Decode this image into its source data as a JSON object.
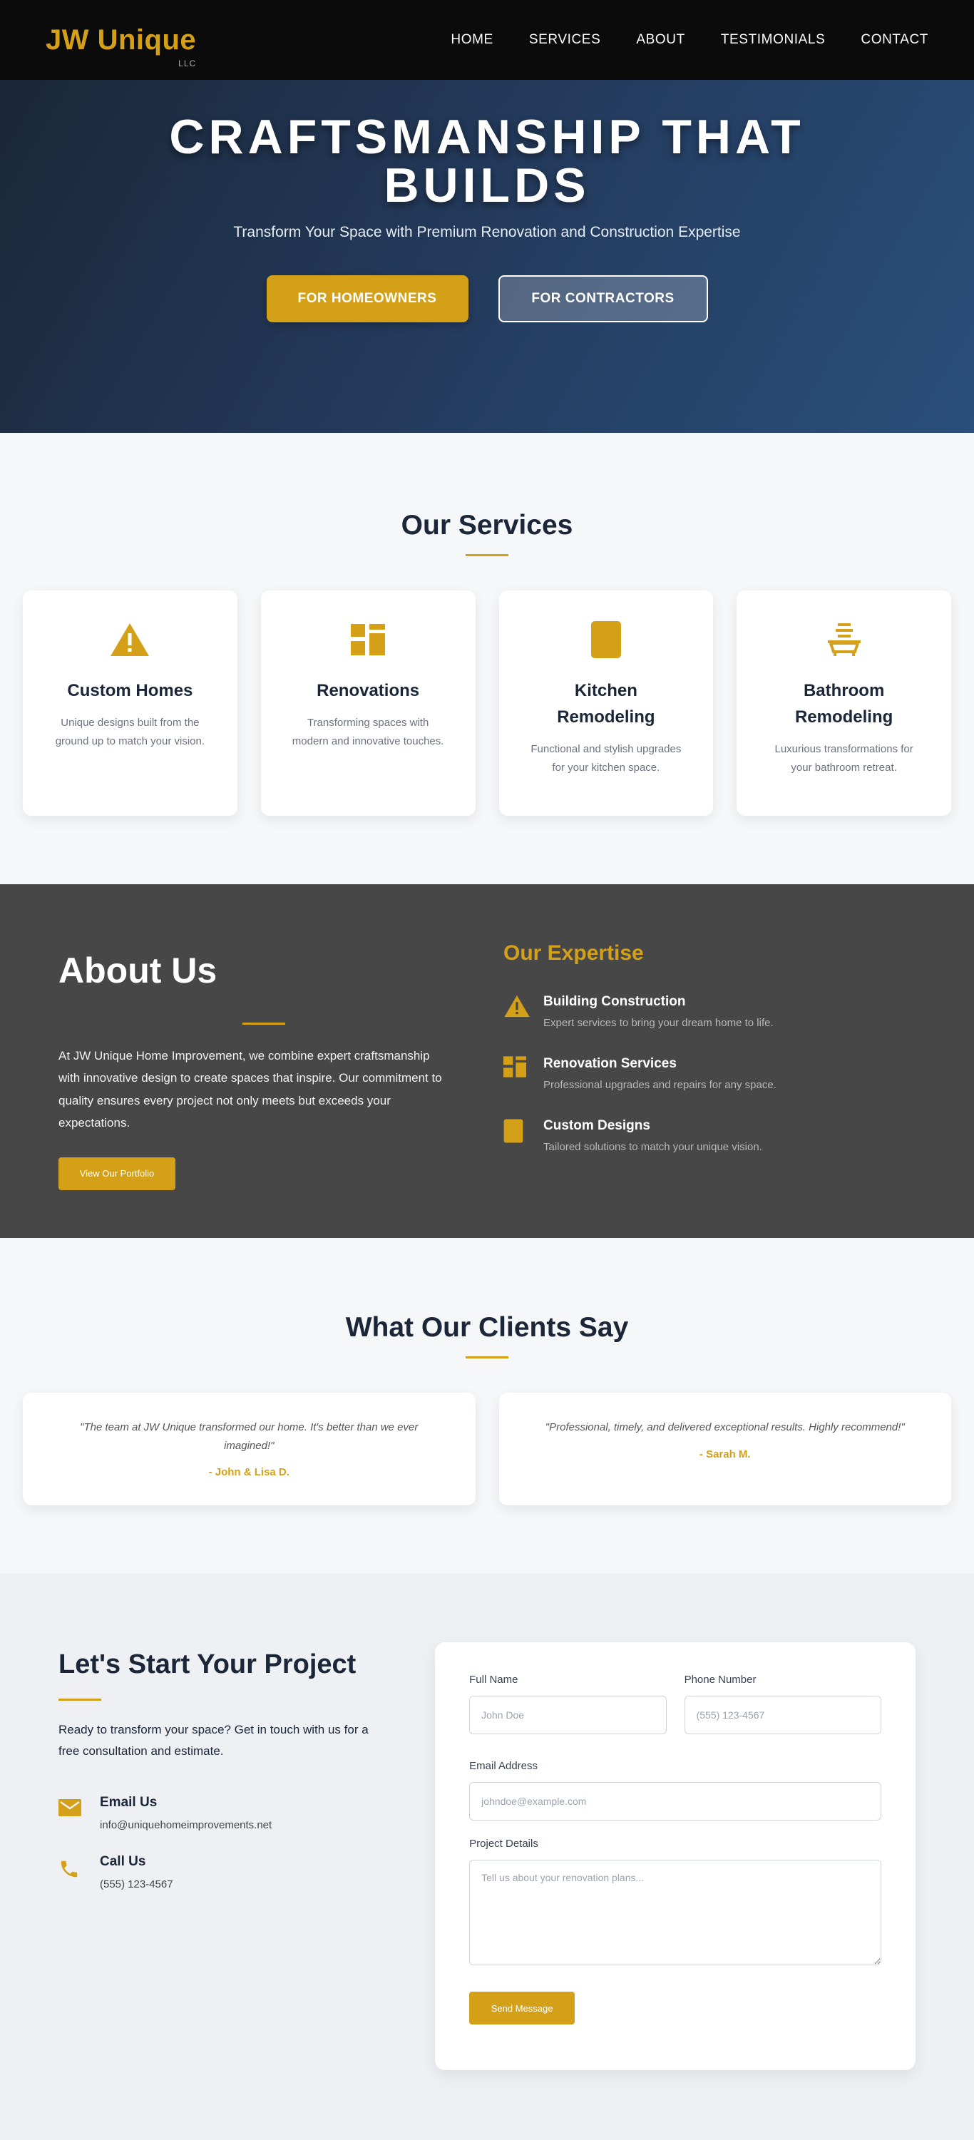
{
  "nav": {
    "brand": "JW Unique",
    "brand_sub": "LLC",
    "items": [
      "HOME",
      "SERVICES",
      "ABOUT",
      "TESTIMONIALS",
      "CONTACT"
    ]
  },
  "hero": {
    "title": "CRAFTSMANSHIP THAT BUILDS",
    "subtitle": "Transform Your Space with Premium Renovation and Construction Expertise",
    "btn_homeowners": "FOR HOMEOWNERS",
    "btn_contractors": "FOR CONTRACTORS"
  },
  "services": {
    "title": "Our Services",
    "items": [
      {
        "icon": "warning-icon",
        "title": "Custom Homes",
        "desc": "Unique designs built from the ground up to match your vision."
      },
      {
        "icon": "grid-icon",
        "title": "Renovations",
        "desc": "Transforming spaces with modern and innovative touches."
      },
      {
        "icon": "tablet-icon",
        "title": "Kitchen Remodeling",
        "desc": "Functional and stylish upgrades for your kitchen space."
      },
      {
        "icon": "bathtub-icon",
        "title": "Bathroom Remodeling",
        "desc": "Luxurious transformations for your bathroom retreat."
      }
    ]
  },
  "about": {
    "title": "About Us",
    "body": "At JW Unique Home Improvement, we combine expert craftsmanship with innovative design to create spaces that inspire. Our commitment to quality ensures every project not only meets but exceeds your expectations.",
    "button": "View Our Portfolio",
    "expertise_title": "Our Expertise",
    "expertise": [
      {
        "icon": "warning-icon",
        "title": "Building Construction",
        "desc": "Expert services to bring your dream home to life."
      },
      {
        "icon": "grid-icon",
        "title": "Renovation Services",
        "desc": "Professional upgrades and repairs for any space."
      },
      {
        "icon": "tablet-icon",
        "title": "Custom Designs",
        "desc": "Tailored solutions to match your unique vision."
      }
    ]
  },
  "testimonials": {
    "title": "What Our Clients Say",
    "items": [
      {
        "quote": "\"The team at JW Unique transformed our home. It's better than we ever imagined!\"",
        "author": "- John & Lisa D."
      },
      {
        "quote": "\"Professional, timely, and delivered exceptional results. Highly recommend!\"",
        "author": "- Sarah M."
      }
    ]
  },
  "contact": {
    "title": "Let's Start Your Project",
    "lead": "Ready to transform your space? Get in touch with us for a free consultation and estimate.",
    "email_label": "Email Us",
    "email_value": "info@uniquehomeimprovements.net",
    "phone_label": "Call Us",
    "phone_value": "(555) 123-4567",
    "form": {
      "name_label": "Full Name",
      "name_placeholder": "John Doe",
      "phone_label": "Phone Number",
      "phone_placeholder": "(555) 123-4567",
      "email_label": "Email Address",
      "email_placeholder": "johndoe@example.com",
      "details_label": "Project Details",
      "details_placeholder": "Tell us about your renovation plans...",
      "submit": "Send Message"
    }
  },
  "colors": {
    "accent": "#d4a017",
    "nav_bg": "#0b0b0c",
    "about_bg": "#474747",
    "heading": "#1b2638"
  }
}
